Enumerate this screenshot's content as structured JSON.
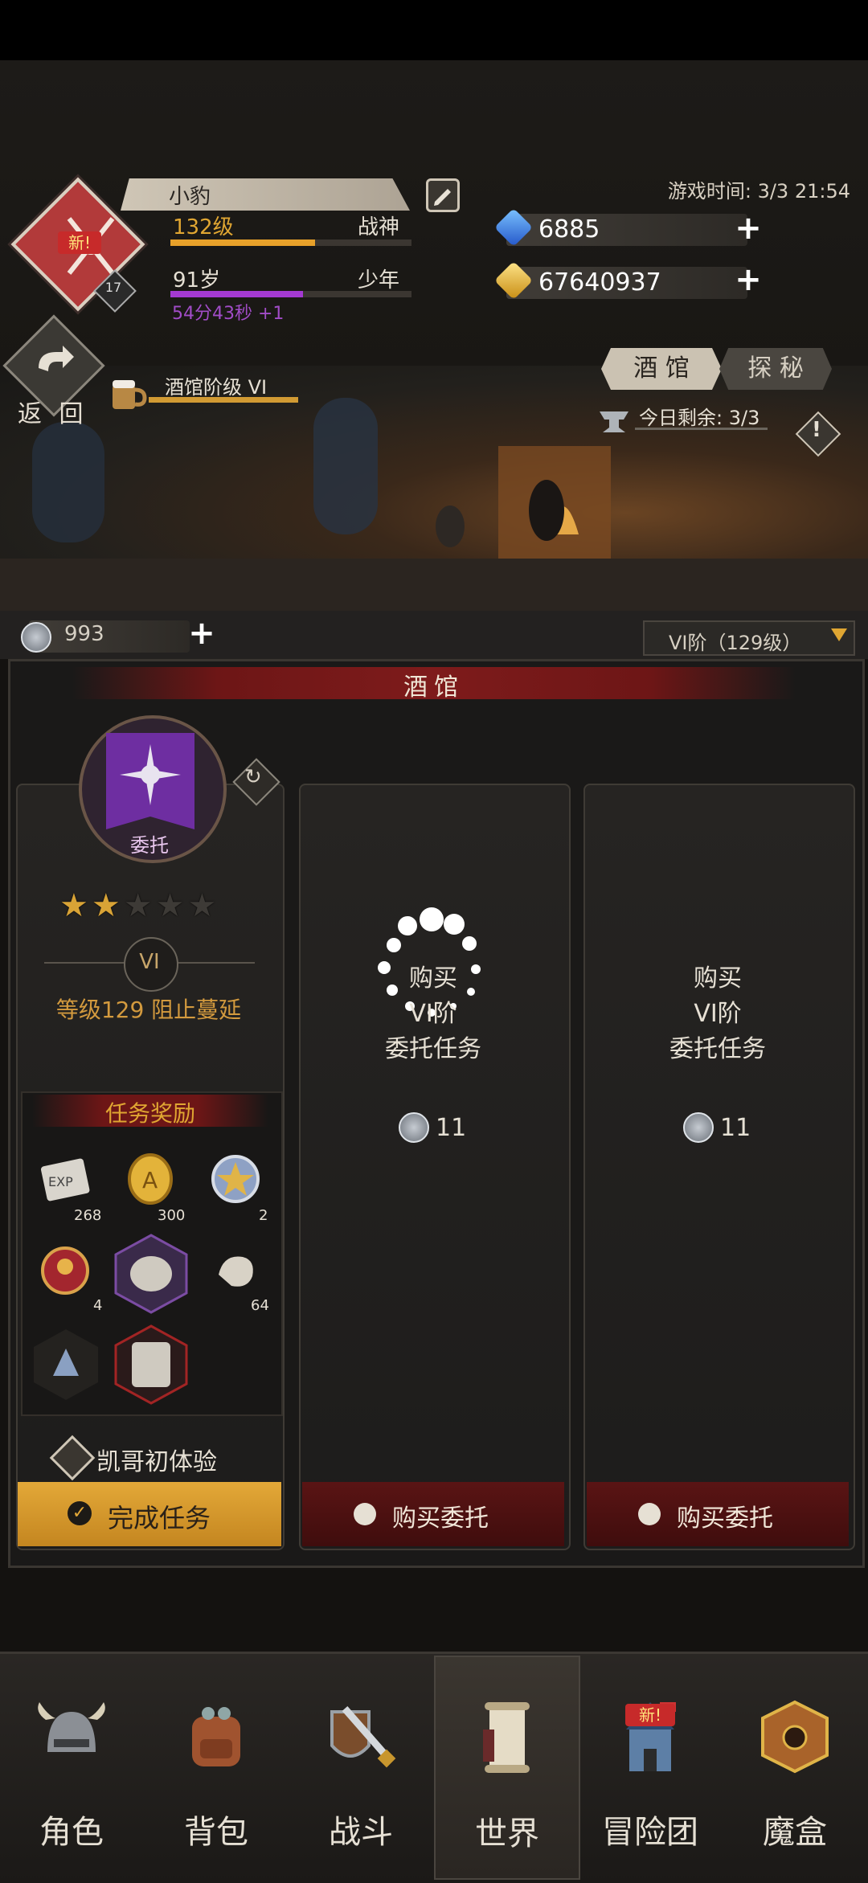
{
  "player": {
    "name": "小豹",
    "level_label": "132级",
    "title": "战神",
    "age_label": "91岁",
    "age_stage": "少年",
    "timer": "54分43秒 +1",
    "new_badge": "新!",
    "rank_badge": "17",
    "level_progress": 0.6,
    "age_progress": 0.55
  },
  "game_time": "游戏时间: 3/3 21:54",
  "currency": {
    "gems": "6885",
    "gold": "67640937",
    "silver": "993"
  },
  "back_label": "返 回",
  "tavern": {
    "rank_label": "酒馆阶级 VI",
    "remaining": "今日剩余: 3/3",
    "tabs": [
      "酒 馆",
      "探 秘"
    ],
    "tier_select": "VI阶（129级）"
  },
  "panel": {
    "title": "酒馆",
    "quest": {
      "emblem_label": "委托",
      "stars": 2,
      "max_stars": 5,
      "tier": "VI",
      "desc": "等级129 阻止蔓延",
      "rewards_title": "任务奖励",
      "rewards": [
        {
          "icon": "exp-scroll-icon",
          "count": "268"
        },
        {
          "icon": "gold-coin-icon",
          "count": "300"
        },
        {
          "icon": "star-coin-icon",
          "count": "2"
        },
        {
          "icon": "red-emblem-icon",
          "count": "4"
        },
        {
          "icon": "silver-ore-icon",
          "count": ""
        },
        {
          "icon": "bone-fragment-icon",
          "count": "64"
        },
        {
          "icon": "rune-crystal-icon",
          "count": ""
        },
        {
          "icon": "stone-tablet-icon",
          "count": ""
        }
      ],
      "quest_name": "凯哥初体验",
      "complete_label": "完成任务"
    },
    "buy_cards": [
      {
        "line1": "购买",
        "line2": "VI阶",
        "line3": "委托任务",
        "price": "11",
        "button": "购买委托"
      },
      {
        "line1": "购买",
        "line2": "VI阶",
        "line3": "委托任务",
        "price": "11",
        "button": "购买委托"
      }
    ]
  },
  "nav": [
    {
      "label": "角色",
      "icon": "helmet-icon"
    },
    {
      "label": "背包",
      "icon": "backpack-icon"
    },
    {
      "label": "战斗",
      "icon": "sword-shield-icon"
    },
    {
      "label": "世界",
      "icon": "scroll-map-icon"
    },
    {
      "label": "冒险团",
      "icon": "castle-icon",
      "badge": "新!"
    },
    {
      "label": "魔盒",
      "icon": "magic-box-icon"
    }
  ],
  "colors": {
    "accent_gold": "#e0a632",
    "xp_bar": "#e8a12a",
    "age_bar": "#a43ad1",
    "button_red": "#5a1414",
    "complete_btn": "#d79a2e"
  }
}
